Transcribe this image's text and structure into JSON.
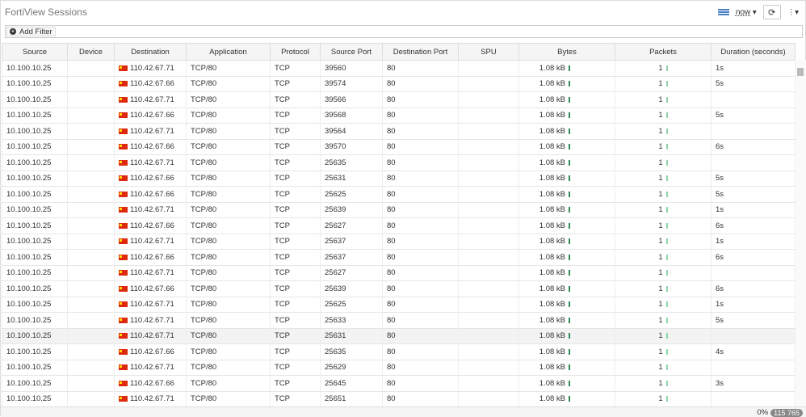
{
  "title": "FortiView Sessions",
  "toolbar": {
    "time": "now",
    "filter_icon": "filter-view-icon",
    "refresh_icon": "refresh-icon",
    "menu_icon": "kebab-menu-icon"
  },
  "filter": {
    "add_label": "Add Filter"
  },
  "columns": [
    "Source",
    "Device",
    "Destination",
    "Application",
    "Protocol",
    "Source Port",
    "Destination Port",
    "SPU",
    "Bytes",
    "Packets",
    "Duration (seconds)"
  ],
  "colors": {
    "bytes_bar": "#2e8b57",
    "packets_bar": "#8fd4a8",
    "flag": "#de2910"
  },
  "rows": [
    {
      "src": "10.100.10.25",
      "dst": "110.42.67.71",
      "app": "TCP/80",
      "proto": "TCP",
      "sport": "39560",
      "dport": "80",
      "bytes": "1.08 kB",
      "packets": "1",
      "dur": "1s"
    },
    {
      "src": "10.100.10.25",
      "dst": "110.42.67.66",
      "app": "TCP/80",
      "proto": "TCP",
      "sport": "39574",
      "dport": "80",
      "bytes": "1.08 kB",
      "packets": "1",
      "dur": "5s"
    },
    {
      "src": "10.100.10.25",
      "dst": "110.42.67.71",
      "app": "TCP/80",
      "proto": "TCP",
      "sport": "39566",
      "dport": "80",
      "bytes": "1.08 kB",
      "packets": "1",
      "dur": ""
    },
    {
      "src": "10.100.10.25",
      "dst": "110.42.67.66",
      "app": "TCP/80",
      "proto": "TCP",
      "sport": "39568",
      "dport": "80",
      "bytes": "1.08 kB",
      "packets": "1",
      "dur": "5s"
    },
    {
      "src": "10.100.10.25",
      "dst": "110.42.67.71",
      "app": "TCP/80",
      "proto": "TCP",
      "sport": "39564",
      "dport": "80",
      "bytes": "1.08 kB",
      "packets": "1",
      "dur": ""
    },
    {
      "src": "10.100.10.25",
      "dst": "110.42.67.66",
      "app": "TCP/80",
      "proto": "TCP",
      "sport": "39570",
      "dport": "80",
      "bytes": "1.08 kB",
      "packets": "1",
      "dur": "6s"
    },
    {
      "src": "10.100.10.25",
      "dst": "110.42.67.71",
      "app": "TCP/80",
      "proto": "TCP",
      "sport": "25635",
      "dport": "80",
      "bytes": "1.08 kB",
      "packets": "1",
      "dur": ""
    },
    {
      "src": "10.100.10.25",
      "dst": "110.42.67.66",
      "app": "TCP/80",
      "proto": "TCP",
      "sport": "25631",
      "dport": "80",
      "bytes": "1.08 kB",
      "packets": "1",
      "dur": "5s"
    },
    {
      "src": "10.100.10.25",
      "dst": "110.42.67.66",
      "app": "TCP/80",
      "proto": "TCP",
      "sport": "25625",
      "dport": "80",
      "bytes": "1.08 kB",
      "packets": "1",
      "dur": "5s"
    },
    {
      "src": "10.100.10.25",
      "dst": "110.42.67.71",
      "app": "TCP/80",
      "proto": "TCP",
      "sport": "25639",
      "dport": "80",
      "bytes": "1.08 kB",
      "packets": "1",
      "dur": "1s"
    },
    {
      "src": "10.100.10.25",
      "dst": "110.42.67.66",
      "app": "TCP/80",
      "proto": "TCP",
      "sport": "25627",
      "dport": "80",
      "bytes": "1.08 kB",
      "packets": "1",
      "dur": "6s"
    },
    {
      "src": "10.100.10.25",
      "dst": "110.42.67.71",
      "app": "TCP/80",
      "proto": "TCP",
      "sport": "25637",
      "dport": "80",
      "bytes": "1.08 kB",
      "packets": "1",
      "dur": "1s"
    },
    {
      "src": "10.100.10.25",
      "dst": "110.42.67.66",
      "app": "TCP/80",
      "proto": "TCP",
      "sport": "25637",
      "dport": "80",
      "bytes": "1.08 kB",
      "packets": "1",
      "dur": "6s"
    },
    {
      "src": "10.100.10.25",
      "dst": "110.42.67.71",
      "app": "TCP/80",
      "proto": "TCP",
      "sport": "25627",
      "dport": "80",
      "bytes": "1.08 kB",
      "packets": "1",
      "dur": ""
    },
    {
      "src": "10.100.10.25",
      "dst": "110.42.67.66",
      "app": "TCP/80",
      "proto": "TCP",
      "sport": "25639",
      "dport": "80",
      "bytes": "1.08 kB",
      "packets": "1",
      "dur": "6s"
    },
    {
      "src": "10.100.10.25",
      "dst": "110.42.67.71",
      "app": "TCP/80",
      "proto": "TCP",
      "sport": "25625",
      "dport": "80",
      "bytes": "1.08 kB",
      "packets": "1",
      "dur": "1s"
    },
    {
      "src": "10.100.10.25",
      "dst": "110.42.67.71",
      "app": "TCP/80",
      "proto": "TCP",
      "sport": "25633",
      "dport": "80",
      "bytes": "1.08 kB",
      "packets": "1",
      "dur": "5s"
    },
    {
      "src": "10.100.10.25",
      "dst": "110.42.67.71",
      "app": "TCP/80",
      "proto": "TCP",
      "sport": "25631",
      "dport": "80",
      "bytes": "1.08 kB",
      "packets": "1",
      "dur": "",
      "highlight": true
    },
    {
      "src": "10.100.10.25",
      "dst": "110.42.67.66",
      "app": "TCP/80",
      "proto": "TCP",
      "sport": "25635",
      "dport": "80",
      "bytes": "1.08 kB",
      "packets": "1",
      "dur": "4s"
    },
    {
      "src": "10.100.10.25",
      "dst": "110.42.67.71",
      "app": "TCP/80",
      "proto": "TCP",
      "sport": "25629",
      "dport": "80",
      "bytes": "1.08 kB",
      "packets": "1",
      "dur": ""
    },
    {
      "src": "10.100.10.25",
      "dst": "110.42.67.66",
      "app": "TCP/80",
      "proto": "TCP",
      "sport": "25645",
      "dport": "80",
      "bytes": "1.08 kB",
      "packets": "1",
      "dur": "3s"
    },
    {
      "src": "10.100.10.25",
      "dst": "110.42.67.71",
      "app": "TCP/80",
      "proto": "TCP",
      "sport": "25651",
      "dport": "80",
      "bytes": "1.08 kB",
      "packets": "1",
      "dur": ""
    }
  ],
  "footer": {
    "progress": "0%",
    "count": "115 765"
  }
}
